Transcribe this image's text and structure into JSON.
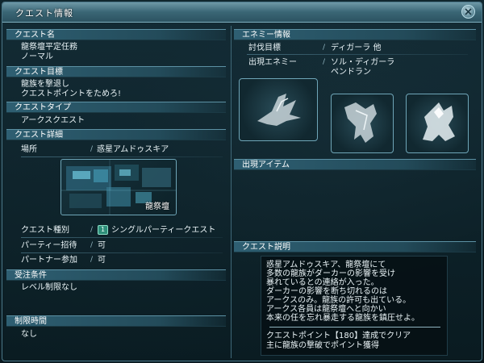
{
  "window": {
    "title": "クエスト情報"
  },
  "left": {
    "quest_name": {
      "header": "クエスト名",
      "lines": [
        "龍祭壇平定任務",
        "ノーマル"
      ]
    },
    "quest_goal": {
      "header": "クエスト目標",
      "lines": [
        "龍族を撃退し",
        "クエストポイントをためろ!"
      ]
    },
    "quest_type": {
      "header": "クエストタイプ",
      "value": "アークスクエスト"
    },
    "quest_detail": {
      "header": "クエスト詳細",
      "location_label": "場所",
      "location_value": "惑星アムドゥスキア",
      "map_label": "龍祭壇",
      "rows": [
        {
          "label": "クエスト種別",
          "badge": "1",
          "value": "シングルパーティークエスト"
        },
        {
          "label": "パーティー招待",
          "value": "可"
        },
        {
          "label": "パートナー参加",
          "value": "可"
        }
      ]
    },
    "conditions": {
      "header": "受注条件",
      "value": "レベル制限なし"
    },
    "time_limit": {
      "header": "制限時間",
      "value": "なし"
    }
  },
  "right": {
    "enemy_info": {
      "header": "エネミー情報",
      "target_label": "討伐目標",
      "target_value": "ディガーラ 他",
      "appear_label": "出現エネミー",
      "appear_values": [
        "ソル・ディガーラ",
        "ペンドラン"
      ],
      "enemy_icons": [
        "dragon-silhouette-icon",
        "dragon-silhouette-icon",
        "dragon-silhouette-icon"
      ]
    },
    "items": {
      "header": "出現アイテム"
    },
    "description": {
      "header": "クエスト説明",
      "lines": [
        "惑星アムドゥスキア、龍祭壇にて",
        "多数の龍族がダーカーの影響を受け",
        "暴れているとの連絡が入った。",
        "ダーカーの影響を断ち切れるのは",
        "アークスのみ。龍族の許可も出ている。",
        "アークス各員は龍祭壇へと向かい",
        "本来の任を忘れ暴走する龍族を鎮圧せよ。"
      ],
      "footer_lines": [
        "クエストポイント【180】達成でクリア",
        "主に龍族の撃破でポイント獲得"
      ]
    }
  },
  "colors": {
    "header_bg": "#2e5f72",
    "border": "#6fa6b8",
    "text": "#e9f3f6",
    "badge": "#2f8f7a"
  }
}
